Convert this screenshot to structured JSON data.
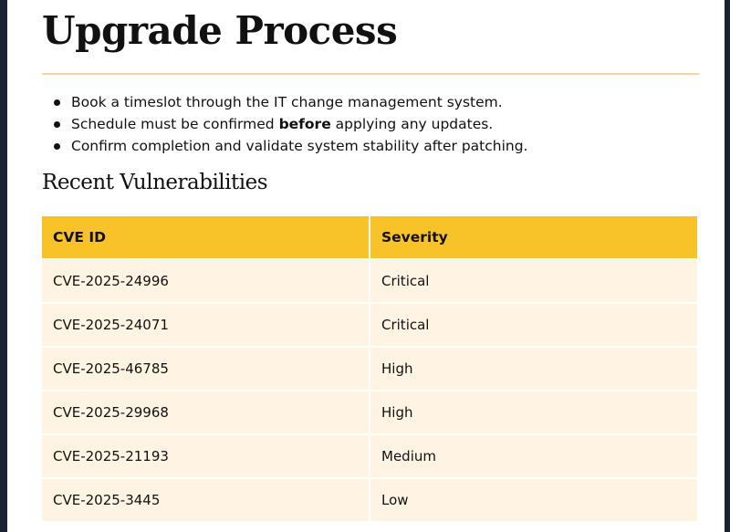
{
  "page": {
    "title": "Upgrade Process"
  },
  "notes": [
    {
      "before": "Book a timeslot through the IT change management system.",
      "bold": "",
      "after": ""
    },
    {
      "before": "Schedule must be confirmed ",
      "bold": "before",
      "after": " applying any updates."
    },
    {
      "before": "Confirm completion and validate system stability after patching.",
      "bold": "",
      "after": ""
    }
  ],
  "vulnerabilities": {
    "heading": "Recent Vulnerabilities",
    "columns": [
      "CVE ID",
      "Severity"
    ],
    "rows": [
      {
        "cve": "CVE-2025-24996",
        "severity": "Critical"
      },
      {
        "cve": "CVE-2025-24071",
        "severity": "Critical"
      },
      {
        "cve": "CVE-2025-46785",
        "severity": "High"
      },
      {
        "cve": "CVE-2025-29968",
        "severity": "High"
      },
      {
        "cve": "CVE-2025-21193",
        "severity": "Medium"
      },
      {
        "cve": "CVE-2025-3445",
        "severity": "Low"
      }
    ]
  },
  "colors": {
    "header_bg": "#f7c328",
    "row_bg": "#fff4e3",
    "divider": "#f2d7a4",
    "frame": "#1b2333"
  }
}
